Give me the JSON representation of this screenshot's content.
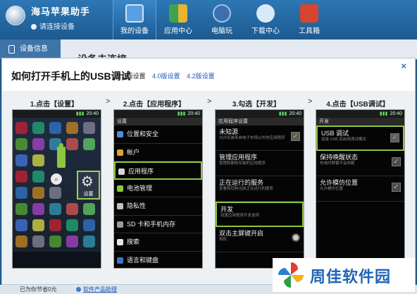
{
  "app": {
    "title": "海马苹果助手",
    "connection_status": "请连接设备"
  },
  "nav": {
    "items": [
      {
        "label": "我的设备",
        "icon": "phone-icon",
        "color": "#5aa0e0",
        "active": true
      },
      {
        "label": "应用中心",
        "icon": "apps-icon",
        "color": "#3fa34d",
        "active": false
      },
      {
        "label": "电脑玩",
        "icon": "gamepad-icon",
        "color": "#3d6fb0",
        "active": false
      },
      {
        "label": "下载中心",
        "icon": "cloud-download-icon",
        "color": "#d9e9f7",
        "active": false
      },
      {
        "label": "工具箱",
        "icon": "toolbox-icon",
        "color": "#d6452f",
        "active": false
      }
    ]
  },
  "sidebar": {
    "device_info": "设备信息"
  },
  "background": {
    "heading": "设备未连接"
  },
  "dialog": {
    "title": "如何打开手机上的USB调试",
    "close": "×",
    "versions": [
      "2.3版设置",
      "4.0版设置",
      "4.2版设置"
    ],
    "active_version": 0,
    "steps": [
      {
        "label": "1.点击【设置】"
      },
      {
        "label": "2.点击【应用程序】"
      },
      {
        "label": "3.勾选【开发】"
      },
      {
        "label": "4.点击【USB调试】"
      }
    ],
    "arrow": ">"
  },
  "phones": {
    "time": "20:40",
    "phone1": {
      "settings_label": "设置",
      "search_icon": "search-icon",
      "gear_icon": "gear-icon"
    },
    "phone2": {
      "header": "设置",
      "rows": [
        {
          "label": "位置和安全",
          "icon_color": "#4c8fd6"
        },
        {
          "label": "帐户",
          "icon_color": "#e0a32e"
        },
        {
          "label": "应用程序",
          "icon_color": "#d7d7d7",
          "highlight": true
        },
        {
          "label": "电池管理",
          "icon_color": "#8cc63f"
        },
        {
          "label": "隐私性",
          "icon_color": "#c0c0c0"
        },
        {
          "label": "SD 卡和手机内存",
          "icon_color": "#9a9a9a"
        },
        {
          "label": "搜索",
          "icon_color": "#e6e6e6"
        },
        {
          "label": "语言和键盘",
          "icon_color": "#3a78c2"
        }
      ]
    },
    "phone3": {
      "header": "应用程序设置",
      "rows": [
        {
          "title": "未知源",
          "desc": "允许安装来自电子市场以外的应用程序",
          "control": "check",
          "checked": true
        },
        {
          "title": "管理应用程序",
          "desc": "管理和删除安装的应用程序",
          "control": "none"
        },
        {
          "title": "正在运行的服务",
          "desc": "查看和控制当前正在运行的服务",
          "control": "none"
        },
        {
          "title": "开发",
          "desc": "设置应用程序开发选项",
          "control": "none",
          "highlight": true
        },
        {
          "title": "双击主屏键开启",
          "desc": "相机",
          "control": "radio"
        }
      ]
    },
    "phone4": {
      "header": "开发",
      "rows": [
        {
          "title": "USB 调试",
          "desc": "连接 USB 后启用调试模式",
          "checked": true,
          "highlight": true
        },
        {
          "title": "保持唤醒状态",
          "desc": "充电时屏幕不会休眠",
          "checked": true
        },
        {
          "title": "允许模仿位置",
          "desc": "允许模仿位置",
          "checked": true
        }
      ]
    }
  },
  "statusbar": {
    "count": "已为你节省0元",
    "link": "软件产品助理"
  },
  "watermark": {
    "text": "周佳软件园"
  }
}
